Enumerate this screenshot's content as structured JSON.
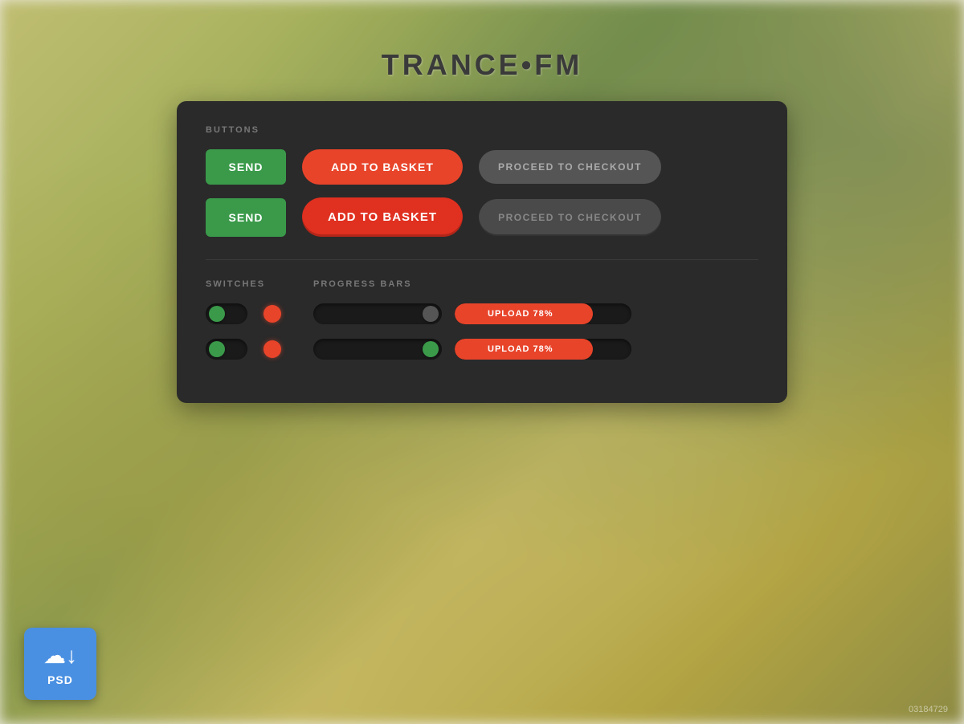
{
  "logo": {
    "text": "TRANCE•FM"
  },
  "panel": {
    "sections": {
      "buttons": {
        "label": "BUTTONS",
        "row1": {
          "send": "SEND",
          "basket": "ADD TO BASKET",
          "checkout": "PROCEED TO CHECKOUT"
        },
        "row2": {
          "send": "SEND",
          "basket": "ADD TO BASKET",
          "checkout": "PROCEED TO CHECKOUT"
        }
      },
      "switches": {
        "label": "SWITCHES"
      },
      "progress": {
        "label": "PROGRESS BARS",
        "bar1": {
          "text": "UPLOAD  78%",
          "percent": 78
        },
        "bar2": {
          "text": "UPLOAD  78%",
          "percent": 78
        }
      }
    }
  },
  "psd": {
    "label": "PSD"
  },
  "watermark": "03184729"
}
